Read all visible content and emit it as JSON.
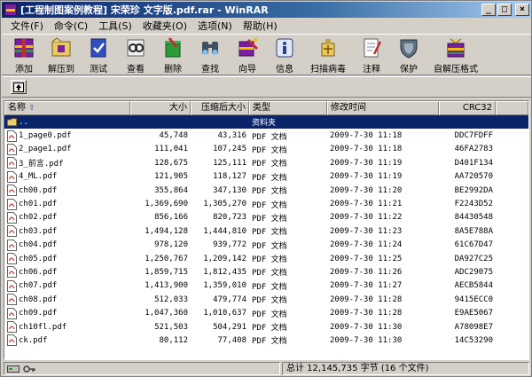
{
  "window": {
    "title": "[工程制图案例教程] 宋荣珍 文字版.pdf.rar - WinRAR"
  },
  "menu": [
    "文件(F)",
    "命令(C)",
    "工具(S)",
    "收藏夹(O)",
    "选项(N)",
    "帮助(H)"
  ],
  "toolbar": [
    {
      "label": "添加",
      "icon": "add-archive-icon"
    },
    {
      "label": "解压到",
      "icon": "extract-to-icon"
    },
    {
      "label": "测试",
      "icon": "test-icon"
    },
    {
      "label": "查看",
      "icon": "view-icon"
    },
    {
      "label": "删除",
      "icon": "delete-icon"
    },
    {
      "label": "查找",
      "icon": "find-icon"
    },
    {
      "label": "向导",
      "icon": "wizard-icon"
    },
    {
      "label": "信息",
      "icon": "info-icon"
    },
    {
      "label": "扫描病毒",
      "icon": "scan-virus-icon"
    },
    {
      "label": "注释",
      "icon": "comment-icon"
    },
    {
      "label": "保护",
      "icon": "protect-icon"
    },
    {
      "label": "自解压格式",
      "icon": "sfx-icon"
    }
  ],
  "columns": {
    "name": "名称",
    "size": "大小",
    "packed": "压缩后大小",
    "type": "类型",
    "modified": "修改时间",
    "crc": "CRC32"
  },
  "parent_row": {
    "name": "..",
    "type": "资料夹"
  },
  "files": [
    {
      "name": "1_page0.pdf",
      "size": "45,748",
      "packed": "43,316",
      "type": "PDF 文档",
      "modified": "2009-7-30 11:18",
      "crc": "DDC7FDFF"
    },
    {
      "name": "2_page1.pdf",
      "size": "111,041",
      "packed": "107,245",
      "type": "PDF 文档",
      "modified": "2009-7-30 11:18",
      "crc": "46FA2783"
    },
    {
      "name": "3_前言.pdf",
      "size": "128,675",
      "packed": "125,111",
      "type": "PDF 文档",
      "modified": "2009-7-30 11:19",
      "crc": "D401F134"
    },
    {
      "name": "4_ML.pdf",
      "size": "121,905",
      "packed": "118,127",
      "type": "PDF 文档",
      "modified": "2009-7-30 11:19",
      "crc": "AA720570"
    },
    {
      "name": "ch00.pdf",
      "size": "355,864",
      "packed": "347,130",
      "type": "PDF 文档",
      "modified": "2009-7-30 11:20",
      "crc": "BE2992DA"
    },
    {
      "name": "ch01.pdf",
      "size": "1,369,690",
      "packed": "1,305,270",
      "type": "PDF 文档",
      "modified": "2009-7-30 11:21",
      "crc": "F2243D52"
    },
    {
      "name": "ch02.pdf",
      "size": "856,166",
      "packed": "820,723",
      "type": "PDF 文档",
      "modified": "2009-7-30 11:22",
      "crc": "84430548"
    },
    {
      "name": "ch03.pdf",
      "size": "1,494,128",
      "packed": "1,444,810",
      "type": "PDF 文档",
      "modified": "2009-7-30 11:23",
      "crc": "8A5E788A"
    },
    {
      "name": "ch04.pdf",
      "size": "978,120",
      "packed": "939,772",
      "type": "PDF 文档",
      "modified": "2009-7-30 11:24",
      "crc": "61C67D47"
    },
    {
      "name": "ch05.pdf",
      "size": "1,250,767",
      "packed": "1,209,142",
      "type": "PDF 文档",
      "modified": "2009-7-30 11:25",
      "crc": "DA927C25"
    },
    {
      "name": "ch06.pdf",
      "size": "1,859,715",
      "packed": "1,812,435",
      "type": "PDF 文档",
      "modified": "2009-7-30 11:26",
      "crc": "ADC29075"
    },
    {
      "name": "ch07.pdf",
      "size": "1,413,900",
      "packed": "1,359,010",
      "type": "PDF 文档",
      "modified": "2009-7-30 11:27",
      "crc": "AECB5844"
    },
    {
      "name": "ch08.pdf",
      "size": "512,033",
      "packed": "479,774",
      "type": "PDF 文档",
      "modified": "2009-7-30 11:28",
      "crc": "9415ECC0"
    },
    {
      "name": "ch09.pdf",
      "size": "1,047,360",
      "packed": "1,010,637",
      "type": "PDF 文档",
      "modified": "2009-7-30 11:28",
      "crc": "E9AE5067"
    },
    {
      "name": "ch10fl.pdf",
      "size": "521,503",
      "packed": "504,291",
      "type": "PDF 文档",
      "modified": "2009-7-30 11:30",
      "crc": "A78098E7"
    },
    {
      "name": "ck.pdf",
      "size": "80,112",
      "packed": "77,408",
      "type": "PDF 文档",
      "modified": "2009-7-30 11:30",
      "crc": "14C53290"
    }
  ],
  "status": {
    "summary": "总计 12,145,735 字节 (16 个文件)"
  }
}
